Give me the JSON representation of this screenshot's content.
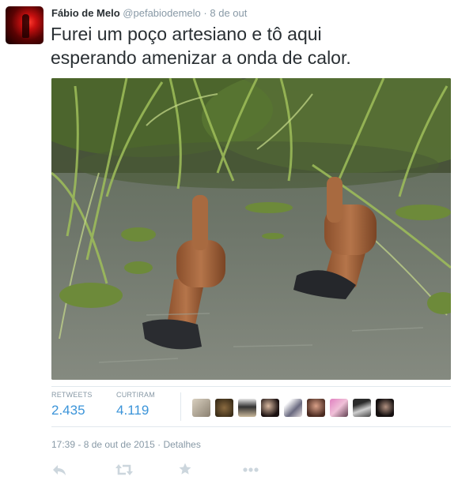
{
  "tweet": {
    "author_name": "Fábio de Melo",
    "author_handle": "@pefabiodemelo",
    "separator": "·",
    "date": "8 de out",
    "text_line1": "Furei um poço artesiano e tô aqui",
    "text_line2": "esperando amenizar a onda de calor."
  },
  "stats": {
    "retweets_label": "RETWEETS",
    "retweets_value": "2.435",
    "likes_label": "CURTIRAM",
    "likes_value": "4.119"
  },
  "meta": {
    "timestamp": "17:39 - 8 de out de 2015",
    "separator": "·",
    "details_label": "Detalhes"
  },
  "icons": {
    "reply": "reply-icon",
    "retweet": "retweet-icon",
    "favorite": "star-icon",
    "more": "more-dots-icon"
  },
  "colors": {
    "link": "#3b94d9",
    "muted": "#8899a6",
    "icon": "#ccd6dd",
    "text": "#292f33"
  }
}
